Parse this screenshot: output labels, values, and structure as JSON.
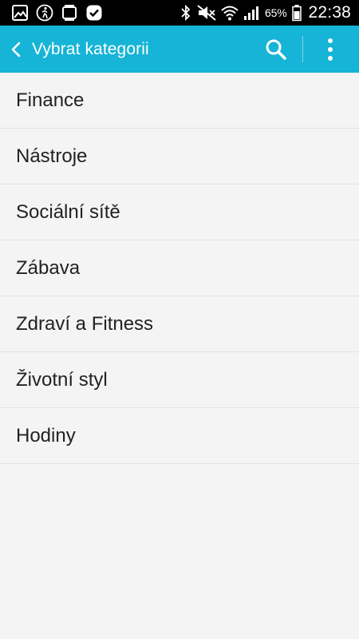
{
  "status_bar": {
    "battery": "65%",
    "time": "22:38",
    "icons": [
      "gallery-icon",
      "fitness-icon",
      "watch-icon",
      "check-badge-icon",
      "bluetooth-icon",
      "mute-icon",
      "wifi-icon",
      "signal-icon",
      "battery-icon"
    ]
  },
  "action_bar": {
    "title": "Vybrat kategorii",
    "background": "#16b4d6",
    "icons": [
      "back-chevron-icon",
      "search-icon",
      "overflow-menu-icon"
    ]
  },
  "categories": [
    {
      "label": "Finance"
    },
    {
      "label": "Nástroje"
    },
    {
      "label": "Sociální sítě"
    },
    {
      "label": "Zábava"
    },
    {
      "label": "Zdraví a Fitness"
    },
    {
      "label": "Životní styl"
    },
    {
      "label": "Hodiny"
    }
  ]
}
